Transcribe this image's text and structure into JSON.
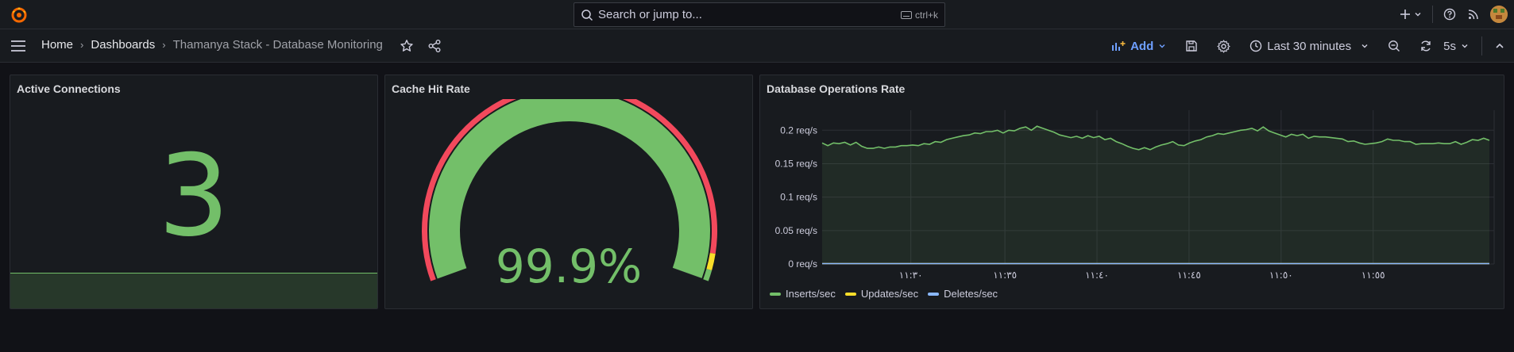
{
  "topbar": {
    "search_placeholder": "Search or jump to...",
    "search_shortcut": "ctrl+k",
    "icons": [
      "grafana-logo",
      "search-icon",
      "keyboard-icon",
      "plus-icon",
      "help-icon",
      "news-icon",
      "user-avatar"
    ]
  },
  "nav": {
    "breadcrumbs": [
      "Home",
      "Dashboards",
      "Thamanya Stack - Database Monitoring"
    ],
    "add_label": "Add",
    "time_range": "Last 30 minutes",
    "refresh_interval": "5s"
  },
  "colors": {
    "green": "#73bf69",
    "red": "#f2495c",
    "yellow": "#fade2a",
    "blue": "#8ab8ff",
    "accent": "#6e9fff"
  },
  "panels": {
    "active_connections": {
      "title": "Active Connections",
      "value": "3"
    },
    "cache_hit_rate": {
      "title": "Cache Hit Rate",
      "value": "99.9%",
      "thresholds": [
        {
          "from": 0,
          "to": 95,
          "color": "#f2495c"
        },
        {
          "from": 95,
          "to": 98,
          "color": "#fade2a"
        },
        {
          "from": 98,
          "to": 100,
          "color": "#73bf69"
        }
      ],
      "min": 0,
      "max": 100,
      "fill": 99.9
    },
    "db_ops": {
      "title": "Database Operations Rate"
    }
  },
  "chart_data": {
    "type": "line",
    "title": "Database Operations Rate",
    "xlabel": "",
    "ylabel": "",
    "x_ticks": [
      "١١:٣٠",
      "١١:٣٥",
      "١١:٤٠",
      "١١:٤٥",
      "١١:٥٠",
      "١١:٥٥"
    ],
    "y_ticks": [
      "0 req/s",
      "0.05 req/s",
      "0.1 req/s",
      "0.15 req/s",
      "0.2 req/s"
    ],
    "ylim": [
      0,
      0.23
    ],
    "grid": true,
    "legend_position": "bottom-left",
    "series": [
      {
        "name": "Inserts/sec",
        "color": "#73bf69",
        "values": [
          0.181,
          0.177,
          0.181,
          0.18,
          0.182,
          0.178,
          0.182,
          0.176,
          0.173,
          0.173,
          0.175,
          0.173,
          0.175,
          0.175,
          0.177,
          0.177,
          0.178,
          0.177,
          0.18,
          0.179,
          0.183,
          0.182,
          0.186,
          0.188,
          0.19,
          0.192,
          0.193,
          0.196,
          0.195,
          0.198,
          0.198,
          0.2,
          0.196,
          0.2,
          0.199,
          0.203,
          0.205,
          0.2,
          0.206,
          0.203,
          0.2,
          0.197,
          0.193,
          0.191,
          0.189,
          0.191,
          0.188,
          0.192,
          0.189,
          0.191,
          0.186,
          0.188,
          0.183,
          0.18,
          0.176,
          0.173,
          0.171,
          0.174,
          0.171,
          0.175,
          0.178,
          0.18,
          0.183,
          0.178,
          0.177,
          0.181,
          0.184,
          0.186,
          0.19,
          0.192,
          0.195,
          0.194,
          0.196,
          0.198,
          0.2,
          0.201,
          0.203,
          0.199,
          0.205,
          0.199,
          0.196,
          0.193,
          0.19,
          0.194,
          0.192,
          0.194,
          0.188,
          0.191,
          0.19,
          0.19,
          0.189,
          0.188,
          0.187,
          0.183,
          0.184,
          0.181,
          0.179,
          0.18,
          0.181,
          0.183,
          0.187,
          0.185,
          0.185,
          0.183,
          0.183,
          0.179,
          0.18,
          0.18,
          0.18,
          0.181,
          0.18,
          0.18,
          0.183,
          0.179,
          0.182,
          0.186,
          0.185,
          0.188,
          0.185
        ]
      },
      {
        "name": "Updates/sec",
        "color": "#fade2a",
        "values": [
          0,
          0
        ]
      },
      {
        "name": "Deletes/sec",
        "color": "#8ab8ff",
        "values": [
          0,
          0
        ]
      }
    ]
  }
}
